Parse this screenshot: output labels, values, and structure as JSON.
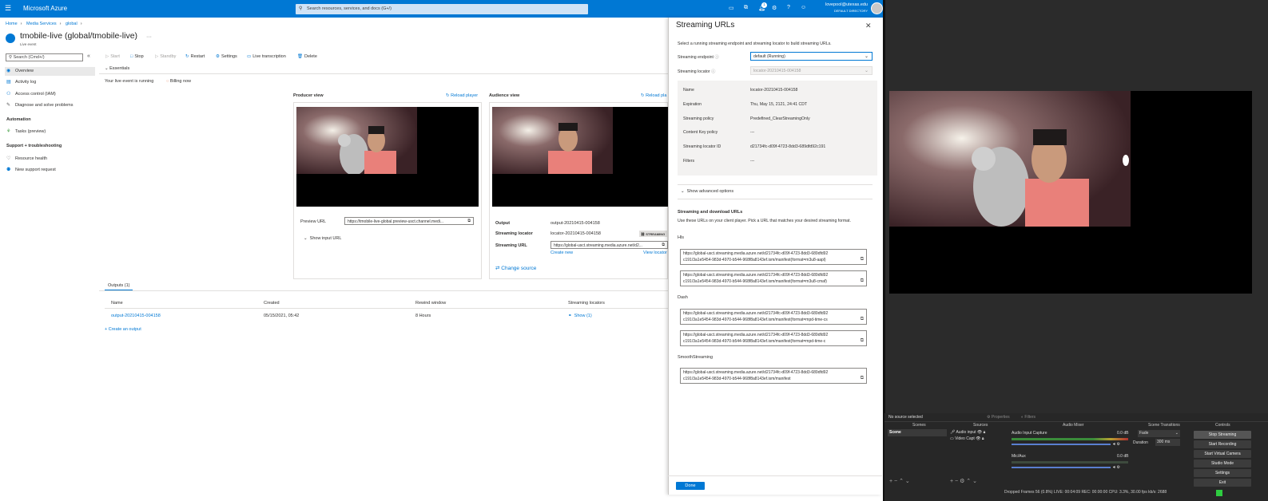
{
  "topbar": {
    "brand": "Microsoft Azure",
    "search_placeholder": "Search resources, services, and docs (G+/)",
    "notification_count": "1",
    "user_email": "lovepool@utexas.edu",
    "user_directory": "DEFAULT DIRECTORY"
  },
  "breadcrumb": [
    "Home",
    "Media Services",
    "global"
  ],
  "page": {
    "title": "tmobile-live (global/tmobile-live)",
    "subtitle": "Live event",
    "more": "···"
  },
  "sidebar": {
    "search_placeholder": "Search (Cmd+/)",
    "items": [
      "Overview",
      "Activity log",
      "Access control (IAM)",
      "Diagnose and solve problems"
    ],
    "automation_header": "Automation",
    "automation_items": [
      "Tasks (preview)"
    ],
    "support_header": "Support + troubleshooting",
    "support_items": [
      "Resource health",
      "New support request"
    ]
  },
  "toolbar": {
    "start": "Start",
    "stop": "Stop",
    "standby": "Standby",
    "restart": "Restart",
    "settings": "Settings",
    "live_transcription": "Live transcription",
    "delete": "Delete"
  },
  "essentials": {
    "label": "Essentials",
    "running": "Your live event is running",
    "billing": "Billing now"
  },
  "producer": {
    "title": "Producer view",
    "reload": "Reload player",
    "preview_url_label": "Preview URL",
    "preview_url": "https://tmobile-live-global.preview-usct.channel.medi...",
    "show_input": "Show input URL"
  },
  "audience": {
    "title": "Audience view",
    "reload": "Reload pla",
    "output_label": "Output",
    "output_value": "output-20210415-004158",
    "locator_label": "Streaming locator",
    "locator_value": "locator-20210415-004158",
    "streaming_badge": "STREAMING",
    "url_label": "Streaming URL",
    "url_value": "https://global-usct.streaming.media.azure.net/d2...",
    "create_new": "Create new",
    "view_locator": "View locator",
    "change_source": "Change source"
  },
  "outputs": {
    "tab": "Outputs (1)",
    "headers": [
      "Name",
      "Created",
      "Rewind window",
      "Streaming locators"
    ],
    "rows": [
      {
        "name": "output-20210415-004158",
        "created": "05/15/2021, 05:42",
        "rewind": "8 Hours",
        "locators": "Show (1)"
      }
    ],
    "create": "Create an output"
  },
  "streaming_panel": {
    "title": "Streaming URLs",
    "intro": "Select a running streaming endpoint and streaming locator to build streaming URLs.",
    "endpoint_label": "Streaming endpoint",
    "endpoint_value": "default (Running)",
    "locator_label": "Streaming locator",
    "locator_value": "locator-20210415-004158",
    "details": [
      {
        "k": "Name",
        "v": "locator-20210415-004158"
      },
      {
        "k": "Expiration",
        "v": "Thu, May 15, 2121, 24:41 CDT"
      },
      {
        "k": "Streaming policy",
        "v": "Predefined_ClearStreamingOnly"
      },
      {
        "k": "Content Key policy",
        "v": "---"
      },
      {
        "k": "Streaming locator ID",
        "v": "d21734fc-d09f-4723-8dd3-689dfd92c191"
      },
      {
        "k": "Filters",
        "v": "---"
      }
    ],
    "advanced": "Show advanced options",
    "urls_title": "Streaming and download URLs",
    "urls_intro": "Use these URLs on your client player. Pick a URL that matches your desired streaming format.",
    "hls_label": "Hls",
    "dash_label": "Dash",
    "smooth_label": "SmoothStreaming",
    "hls": [
      [
        "https://global-usct.streaming.media.azure.net/d21734fc-d09f-4723-8dd3-689dfd92",
        "c191/3a1e5454-983d-4970-b544-968f8a8143ef.ism/manifest(format=m3u8-aapl)"
      ],
      [
        "https://global-usct.streaming.media.azure.net/d21734fc-d09f-4723-8dd3-689dfd92",
        "c191/3a1e5454-983d-4970-b544-968f8a8143ef.ism/manifest(format=m3u8-cmaf)"
      ]
    ],
    "dash": [
      [
        "https://global-usct.streaming.media.azure.net/d21734fc-d09f-4723-8dd3-689dfd92",
        "c191/3a1e5454-983d-4970-b544-968f8a8143ef.ism/manifest(format=mpd-time-cs"
      ],
      [
        "https://global-usct.streaming.media.azure.net/d21734fc-d09f-4723-8dd3-689dfd92",
        "c191/3a1e5454-983d-4970-b544-968f8a8143ef.ism/manifest(format=mpd-time-c"
      ]
    ],
    "smooth": [
      [
        "https://global-usct.streaming.media.azure.net/d21734fc-d09f-4723-8dd3-689dfd92",
        "c191/3a1e5454-983d-4970-b544-968f8a8143ef.ism/manifest"
      ]
    ],
    "done": "Done"
  },
  "obs": {
    "no_source": "No source selected",
    "properties": "Properties",
    "filters": "Filters",
    "docks": {
      "scenes": "Scenes",
      "sources": "Sources",
      "mixer": "Audio Mixer",
      "transitions": "Scene Transitions",
      "controls": "Controls"
    },
    "scene": "Scene",
    "sources": [
      "Audio input",
      "Video Capt"
    ],
    "mixer": [
      {
        "name": "Audio Input Capture",
        "db": "0.0 dB"
      },
      {
        "name": "Mic/Aux",
        "db": "0.0 dB"
      }
    ],
    "transition": "Fade",
    "duration_label": "Duration",
    "duration_value": "300 ms",
    "controls": [
      "Stop Streaming",
      "Start Recording",
      "Start Virtual Camera",
      "Studio Mode",
      "Settings",
      "Exit"
    ],
    "status": "Dropped Frames 56 (0.8%)   LIVE: 00:04:09   REC: 00:00:00   CPU: 3.3%, 30.00 fps   kb/s: 2688"
  }
}
